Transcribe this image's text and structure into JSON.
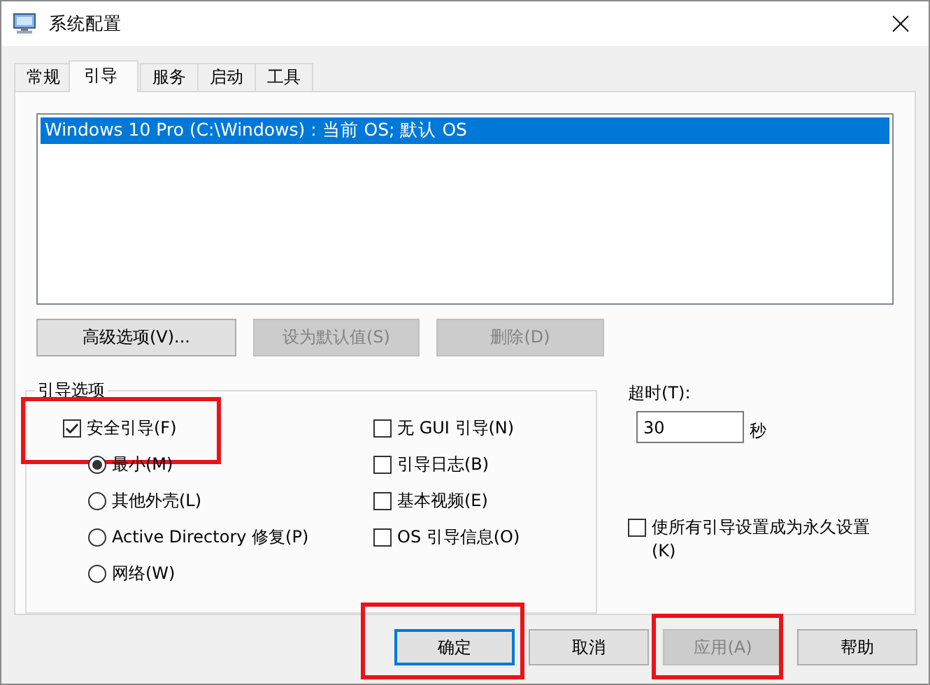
{
  "window": {
    "title": "系统配置"
  },
  "tabs": [
    {
      "label": "常规",
      "selected": false
    },
    {
      "label": "引导",
      "selected": true
    },
    {
      "label": "服务",
      "selected": false
    },
    {
      "label": "启动",
      "selected": false
    },
    {
      "label": "工具",
      "selected": false
    }
  ],
  "boot_list": [
    {
      "text": "Windows 10 Pro (C:\\Windows) : 当前 OS; 默认 OS",
      "selected": true
    }
  ],
  "list_buttons": [
    {
      "label": "高级选项(V)...",
      "disabled": false
    },
    {
      "label": "设为默认值(S)",
      "disabled": true
    },
    {
      "label": "删除(D)",
      "disabled": true
    }
  ],
  "boot_options": {
    "title": "引导选项",
    "safe_boot": {
      "label": "安全引导(F)",
      "checked": true,
      "highlighted": true
    },
    "modes": [
      {
        "label": "最小(M)",
        "selected": true
      },
      {
        "label": "其他外壳(L)",
        "selected": false
      },
      {
        "label": "Active Directory 修复(P)",
        "selected": false
      },
      {
        "label": "网络(W)",
        "selected": false
      }
    ],
    "flags": [
      {
        "label": "无 GUI 引导(N)",
        "checked": false
      },
      {
        "label": "引导日志(B)",
        "checked": false
      },
      {
        "label": "基本视频(E)",
        "checked": false
      },
      {
        "label": "OS 引导信息(O)",
        "checked": false
      }
    ]
  },
  "timeout": {
    "label": "超时(T):",
    "value": "30",
    "unit": "秒"
  },
  "make_permanent": {
    "label": "使所有引导设置成为永久设置(K)",
    "checked": false
  },
  "buttons": [
    {
      "label": "确定",
      "default": true,
      "disabled": false,
      "highlighted": true
    },
    {
      "label": "取消",
      "default": false,
      "disabled": false,
      "highlighted": false
    },
    {
      "label": "应用(A)",
      "default": false,
      "disabled": true,
      "highlighted": true
    },
    {
      "label": "帮助",
      "default": false,
      "disabled": false,
      "highlighted": false
    }
  ]
}
